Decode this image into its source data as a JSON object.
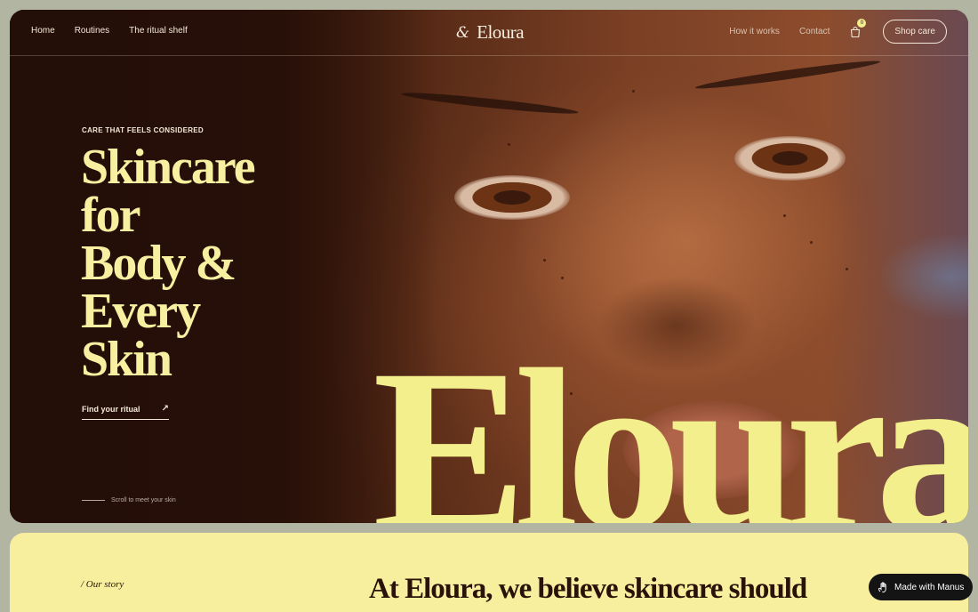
{
  "nav": {
    "left_links": [
      "Home",
      "Routines",
      "The ritual shelf"
    ],
    "logo_mark": "&",
    "logo_text": "Eloura",
    "right_links": [
      "How it works",
      "Contact"
    ],
    "cart_count": "0",
    "shop_button": "Shop care",
    "cart_icon": "shopping-bag-icon"
  },
  "hero": {
    "eyebrow": "CARE THAT FEELS CONSIDERED",
    "headline_lines": [
      "Skincare",
      "for",
      "Body &",
      "Every",
      "Skin"
    ],
    "cta_label": "Find your ritual",
    "cta_icon": "arrow-up-right-icon",
    "scroll_hint": "Scroll to meet your skin",
    "big_word": "Eloura"
  },
  "story": {
    "label": "/ Our story",
    "heading": "At Eloura, we believe skincare should"
  },
  "badge": {
    "label": "Made with Manus",
    "icon": "manus-hand-icon"
  },
  "colors": {
    "accent_yellow": "#f4ef8d",
    "dark_brown": "#2a1209",
    "cream": "#f3e8d8",
    "story_bg": "#f7ef9e"
  }
}
